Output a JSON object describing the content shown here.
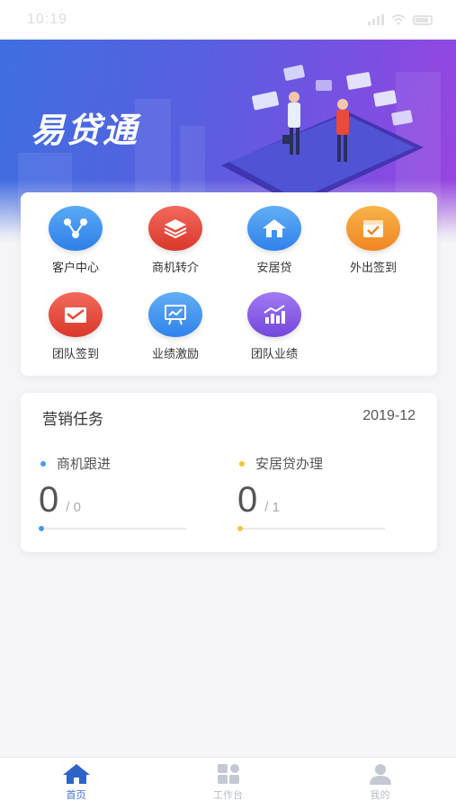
{
  "status_bar": {
    "time": "10:19"
  },
  "banner": {
    "title": "易贷通"
  },
  "quick_menu": {
    "items": [
      {
        "label": "客户中心",
        "icon": "customer-center-icon",
        "color": "#3b8ff2"
      },
      {
        "label": "商机转介",
        "icon": "layers-icon",
        "color": "#e8483a"
      },
      {
        "label": "安居贷",
        "icon": "house-icon",
        "color": "#3e8ff0"
      },
      {
        "label": "外出签到",
        "icon": "calendar-check-icon",
        "color": "#f59a2e"
      },
      {
        "label": "团队签到",
        "icon": "envelope-check-icon",
        "color": "#e8483a"
      },
      {
        "label": "业绩激励",
        "icon": "presentation-chart-icon",
        "color": "#3e8ff0"
      },
      {
        "label": "团队业绩",
        "icon": "bar-chart-icon",
        "color": "#8a5ae6"
      }
    ]
  },
  "marketing_task": {
    "title": "营销任务",
    "date": "2019-12",
    "metrics": [
      {
        "label": "商机跟进",
        "value": "0",
        "total": "/ 0",
        "progress": 0,
        "color": "#4a9ae8"
      },
      {
        "label": "安居贷办理",
        "value": "0",
        "total": "/ 1",
        "progress": 0,
        "color": "#f2c43a"
      }
    ]
  },
  "tab_bar": {
    "tabs": [
      {
        "label": "首页",
        "icon": "home-icon",
        "active": true
      },
      {
        "label": "工作台",
        "icon": "workbench-icon",
        "active": false
      },
      {
        "label": "我的",
        "icon": "user-icon",
        "active": false
      }
    ],
    "active_color": "#2f63c8",
    "inactive_color": "#c4c8d2"
  }
}
